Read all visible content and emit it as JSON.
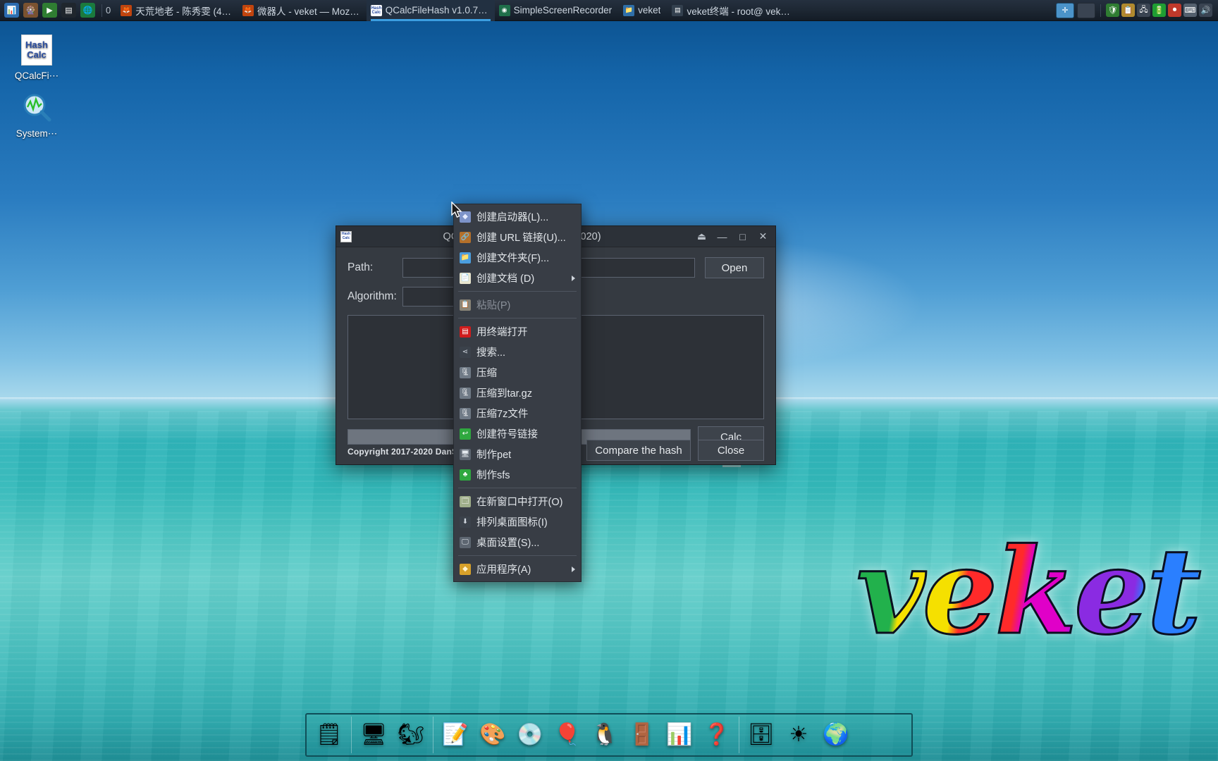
{
  "taskbar": {
    "launchers": [
      {
        "name": "system-monitor-icon",
        "glyph": "📊",
        "bg": "#2b6cb0"
      },
      {
        "name": "package-manager-icon",
        "glyph": "🎡",
        "bg": "#7a5230"
      },
      {
        "name": "media-player-icon",
        "glyph": "▶",
        "bg": "#2f7d32"
      },
      {
        "name": "terminal-icon",
        "glyph": "▤",
        "bg": "#1f262d"
      },
      {
        "name": "browser-icon",
        "glyph": "🌐",
        "bg": "#1b7a3d"
      }
    ],
    "workspace_label": "0",
    "tasks": [
      {
        "name": "task-tianhuangdilao",
        "label": "天荒地老 - 陈秀雯 (4…",
        "icon": "🦊",
        "icon_bg": "#c1440e",
        "active": false
      },
      {
        "name": "task-weiqiren-firefox",
        "label": "微器人 - veket — Moz…",
        "icon": "🦊",
        "icon_bg": "#c1440e",
        "active": false
      },
      {
        "name": "task-qcalcfilehash",
        "label": "QCalcFileHash v1.0.7…",
        "icon": "HC",
        "icon_bg": "#ffffff",
        "active": true
      },
      {
        "name": "task-simplescreenrecorder",
        "label": "SimpleScreenRecorder",
        "icon": "◉",
        "icon_bg": "#1f6f4a",
        "active": false
      },
      {
        "name": "task-veket-folder",
        "label": "veket",
        "icon": "📁",
        "icon_bg": "#2f6fa8",
        "active": false
      },
      {
        "name": "task-veket-terminal",
        "label": "veket终端 - root@ vek…",
        "icon": "▤",
        "icon_bg": "#33404e",
        "active": false
      }
    ],
    "show_desktop_name": "show-desktop-button",
    "minimize_all_name": "minimize-all-button",
    "tray": [
      {
        "name": "tray-firewall-icon",
        "glyph": "🛡",
        "bg": "#2f7d32"
      },
      {
        "name": "tray-clipboard-icon",
        "glyph": "📋",
        "bg": "#b08a2e"
      },
      {
        "name": "tray-network-icon",
        "glyph": "🖧",
        "bg": "#3a4452"
      },
      {
        "name": "tray-battery-icon",
        "glyph": "🔋",
        "bg": "#1f9d33"
      },
      {
        "name": "tray-record-icon",
        "glyph": "⏺",
        "bg": "#c0392b"
      },
      {
        "name": "tray-keyboard-icon",
        "glyph": "⌨",
        "bg": "#54606e"
      },
      {
        "name": "tray-volume-icon",
        "glyph": "🔊",
        "bg": "#3a4452"
      }
    ]
  },
  "desktop": {
    "icons": [
      {
        "name": "desktop-icon-qcalcfilehash",
        "label": "QCalcFi⋯",
        "type": "hashcalc",
        "line1": "Hash",
        "line2": "Calc"
      },
      {
        "name": "desktop-icon-systemmonitor",
        "label": "System⋯",
        "type": "monitor",
        "glyph": "🔍"
      }
    ],
    "logo_text": "veket"
  },
  "dialog": {
    "title": "QCa                       ,2020)",
    "title_full": "QCalcFileHash v1.0.7 (2017-2020)",
    "icon_line1": "Hash",
    "icon_line2": "Calc",
    "window_buttons": [
      {
        "name": "shade-button",
        "glyph": "⏏"
      },
      {
        "name": "minimize-button",
        "glyph": "—"
      },
      {
        "name": "maximize-button",
        "glyph": "□"
      },
      {
        "name": "close-button",
        "glyph": "✕"
      }
    ],
    "path_label": "Path:",
    "path_value": "",
    "path_placeholder": "",
    "open_label": "Open",
    "algorithm_label": "Algorithm:",
    "algorithm_value": "",
    "hash_output": "",
    "progress_percent": 0,
    "calc_label": "Calc",
    "compare_label": "Compare the hash",
    "close_label": "Close",
    "copyright": "Copyright 2017-2020 DanSoft."
  },
  "context_menu": {
    "items": [
      {
        "name": "menu-create-launcher",
        "label": "创建启动器(L)...",
        "icon": "◆",
        "icon_bg": "#7d93c9",
        "icon_color": "#e6ecff",
        "type": "item"
      },
      {
        "name": "menu-create-url-link",
        "label": "创建 URL 链接(U)...",
        "icon": "🔗",
        "icon_bg": "#b4702a",
        "icon_color": "#ffe6b0",
        "type": "item"
      },
      {
        "name": "menu-create-folder",
        "label": "创建文件夹(F)...",
        "icon": "📁",
        "icon_bg": "#4b9fe0",
        "icon_color": "#ffffff",
        "type": "item"
      },
      {
        "name": "menu-create-document",
        "label": "创建文档 (D)",
        "icon": "📄",
        "icon_bg": "#e9e6cf",
        "icon_color": "#6a6a4a",
        "type": "submenu"
      },
      {
        "name": "menu-separator-1",
        "type": "separator"
      },
      {
        "name": "menu-paste",
        "label": "粘贴(P)",
        "icon": "📋",
        "icon_bg": "#8a8578",
        "icon_color": "#f0ece0",
        "type": "disabled"
      },
      {
        "name": "menu-separator-2",
        "type": "separator"
      },
      {
        "name": "menu-open-terminal",
        "label": "用终端打开",
        "icon": "▤",
        "icon_bg": "#d01c1c",
        "icon_color": "#ffffff",
        "type": "item"
      },
      {
        "name": "menu-search",
        "label": "搜索...",
        "icon": "⋖",
        "icon_bg": "#3b424b",
        "icon_color": "#cfd6de",
        "type": "item"
      },
      {
        "name": "menu-compress",
        "label": "压缩",
        "icon": "🗜",
        "icon_bg": "#6f7a86",
        "icon_color": "#ffffff",
        "type": "item"
      },
      {
        "name": "menu-compress-targz",
        "label": "压缩到tar.gz",
        "icon": "🗜",
        "icon_bg": "#6f7a86",
        "icon_color": "#ffffff",
        "type": "item"
      },
      {
        "name": "menu-compress-7z",
        "label": "压缩7z文件",
        "icon": "🗜",
        "icon_bg": "#6f7a86",
        "icon_color": "#ffffff",
        "type": "item"
      },
      {
        "name": "menu-create-symlink",
        "label": "创建符号链接",
        "icon": "↩",
        "icon_bg": "#2fa83f",
        "icon_color": "#ffffff",
        "type": "item"
      },
      {
        "name": "menu-make-pet",
        "label": "制作pet",
        "icon": "🖥",
        "icon_bg": "#5d6671",
        "icon_color": "#e8edf2",
        "type": "item"
      },
      {
        "name": "menu-make-sfs",
        "label": "制作sfs",
        "icon": "♣",
        "icon_bg": "#2fa83f",
        "icon_color": "#ffffff",
        "type": "item"
      },
      {
        "name": "menu-separator-3",
        "type": "separator"
      },
      {
        "name": "menu-open-new-window",
        "label": "在新窗口中打开(O)",
        "icon": "🗔",
        "icon_bg": "#9fae8a",
        "icon_color": "#ffffff",
        "type": "item"
      },
      {
        "name": "menu-arrange-desktop-icons",
        "label": "排列桌面图标(I)",
        "icon": "⬇",
        "icon_bg": "#3b424b",
        "icon_color": "#cfd6de",
        "type": "item"
      },
      {
        "name": "menu-desktop-settings",
        "label": "桌面设置(S)...",
        "icon": "🖵",
        "icon_bg": "#5d6671",
        "icon_color": "#e8edf2",
        "type": "item"
      },
      {
        "name": "menu-separator-4",
        "type": "separator"
      },
      {
        "name": "menu-applications",
        "label": "应用程序(A)",
        "icon": "◆",
        "icon_bg": "#d8a12a",
        "icon_color": "#fff3cf",
        "type": "submenu"
      }
    ]
  },
  "dock": {
    "items": [
      {
        "name": "dock-item-file-manager",
        "glyph": "🗒"
      },
      {
        "name": "dock-separator-1",
        "glyph": "|",
        "sep": true
      },
      {
        "name": "dock-item-desktop",
        "glyph": "🖥"
      },
      {
        "name": "dock-item-firefox",
        "glyph": "🐿"
      },
      {
        "name": "dock-separator-2",
        "glyph": "|",
        "sep": true
      },
      {
        "name": "dock-item-text-editor",
        "glyph": "📝"
      },
      {
        "name": "dock-item-paint",
        "glyph": "🎨"
      },
      {
        "name": "dock-item-media-player",
        "glyph": "💿"
      },
      {
        "name": "dock-item-downloader",
        "glyph": "🎈"
      },
      {
        "name": "dock-item-penguin",
        "glyph": "🐧"
      },
      {
        "name": "dock-item-archive",
        "glyph": "🚪"
      },
      {
        "name": "dock-item-office",
        "glyph": "📊"
      },
      {
        "name": "dock-item-help",
        "glyph": "❓"
      },
      {
        "name": "dock-separator-3",
        "glyph": "|",
        "sep": true
      },
      {
        "name": "dock-item-files",
        "glyph": "🗄"
      },
      {
        "name": "dock-item-settings",
        "glyph": "☀"
      },
      {
        "name": "dock-item-browser",
        "glyph": "🌍"
      }
    ]
  }
}
